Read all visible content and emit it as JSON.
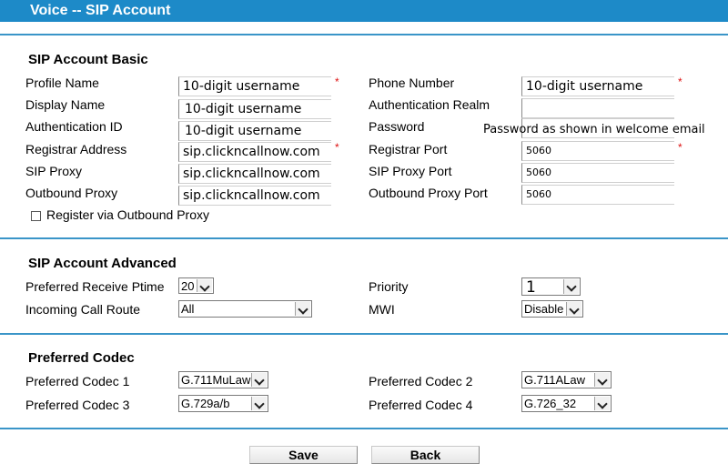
{
  "header": {
    "title": "Voice -- SIP Account"
  },
  "basic": {
    "section_title": "SIP Account Basic",
    "profile_name": {
      "label": "Profile Name",
      "value": "10-digit username"
    },
    "display_name": {
      "label": "Display Name",
      "value": "10-digit username"
    },
    "auth_id": {
      "label": "Authentication ID",
      "value": "10-digit username"
    },
    "registrar_address": {
      "label": "Registrar Address",
      "value": "sip.clickncallnow.com"
    },
    "sip_proxy": {
      "label": "SIP Proxy",
      "value": "sip.clickncallnow.com"
    },
    "outbound_proxy": {
      "label": "Outbound Proxy",
      "value": "sip.clickncallnow.com"
    },
    "phone_number": {
      "label": "Phone Number",
      "value": "10-digit username"
    },
    "auth_realm": {
      "label": "Authentication Realm",
      "value": ""
    },
    "password": {
      "label": "Password",
      "value": "Password as shown in welcome email"
    },
    "registrar_port": {
      "label": "Registrar Port",
      "value": "5060"
    },
    "sip_proxy_port": {
      "label": "SIP Proxy Port",
      "value": "5060"
    },
    "outbound_proxy_port": {
      "label": "Outbound Proxy Port",
      "value": "5060"
    },
    "register_via_outbound": {
      "label": "Register via Outbound Proxy",
      "checked": false
    },
    "required_mark": "*"
  },
  "advanced": {
    "section_title": "SIP Account Advanced",
    "ptime": {
      "label": "Preferred Receive Ptime",
      "value": "20"
    },
    "incoming_route": {
      "label": "Incoming Call Route",
      "value": "All"
    },
    "priority": {
      "label": "Priority",
      "value": "1"
    },
    "mwi": {
      "label": "MWI",
      "value": "Disable"
    }
  },
  "codec": {
    "section_title": "Preferred Codec",
    "codec1": {
      "label": "Preferred Codec 1",
      "value": "G.711MuLaw"
    },
    "codec2": {
      "label": "Preferred Codec 2",
      "value": "G.711ALaw"
    },
    "codec3": {
      "label": "Preferred Codec 3",
      "value": "G.729a/b"
    },
    "codec4": {
      "label": "Preferred Codec 4",
      "value": "G.726_32"
    }
  },
  "buttons": {
    "save": "Save",
    "back": "Back"
  },
  "colors": {
    "header_bg": "#1d8ac8",
    "separator": "#3a95c8",
    "required": "#dd1111"
  }
}
